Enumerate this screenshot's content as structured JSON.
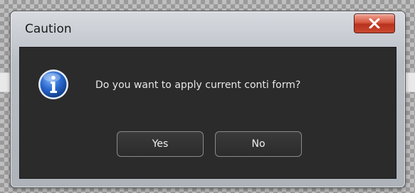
{
  "dialog": {
    "title": "Caution",
    "message": "Do you want to apply current conti form?",
    "buttons": {
      "yes": "Yes",
      "no": "No"
    },
    "icons": {
      "message_icon": "info-icon",
      "close_icon": "close-icon"
    }
  },
  "colors": {
    "content_bg": "#2b2b2b",
    "close_button": "#c9452f",
    "info_icon": "#1f5fc0"
  }
}
